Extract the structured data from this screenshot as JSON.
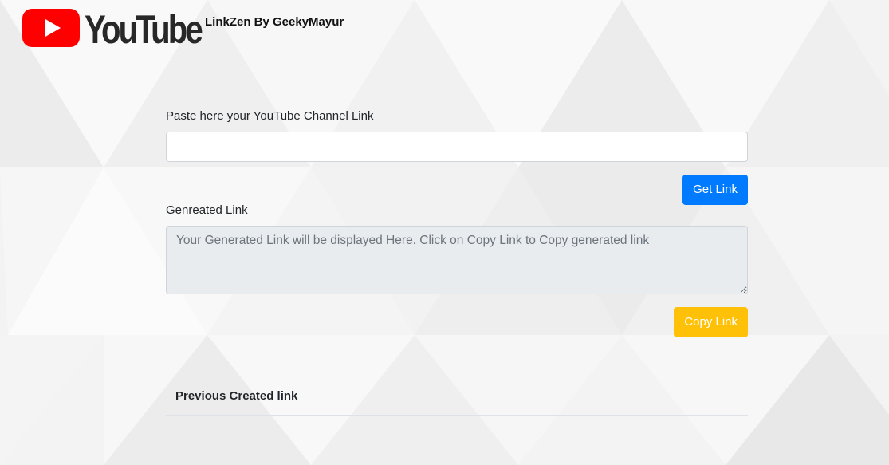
{
  "header": {
    "logo_text": "YouTube",
    "app_title": "LinkZen By GeekyMayur"
  },
  "form": {
    "url_label": "Paste here your YouTube Channel Link",
    "url_value": "",
    "get_link_label": "Get Link",
    "generated_label": "Genreated Link",
    "generated_placeholder": "Your Generated Link will be displayed Here. Click on Copy Link to Copy generated link",
    "copy_link_label": "Copy Link"
  },
  "previous": {
    "heading": "Previous Created link"
  },
  "colors": {
    "primary": "#007bff",
    "warning": "#ffc107",
    "youtube_red": "#ff0000"
  }
}
